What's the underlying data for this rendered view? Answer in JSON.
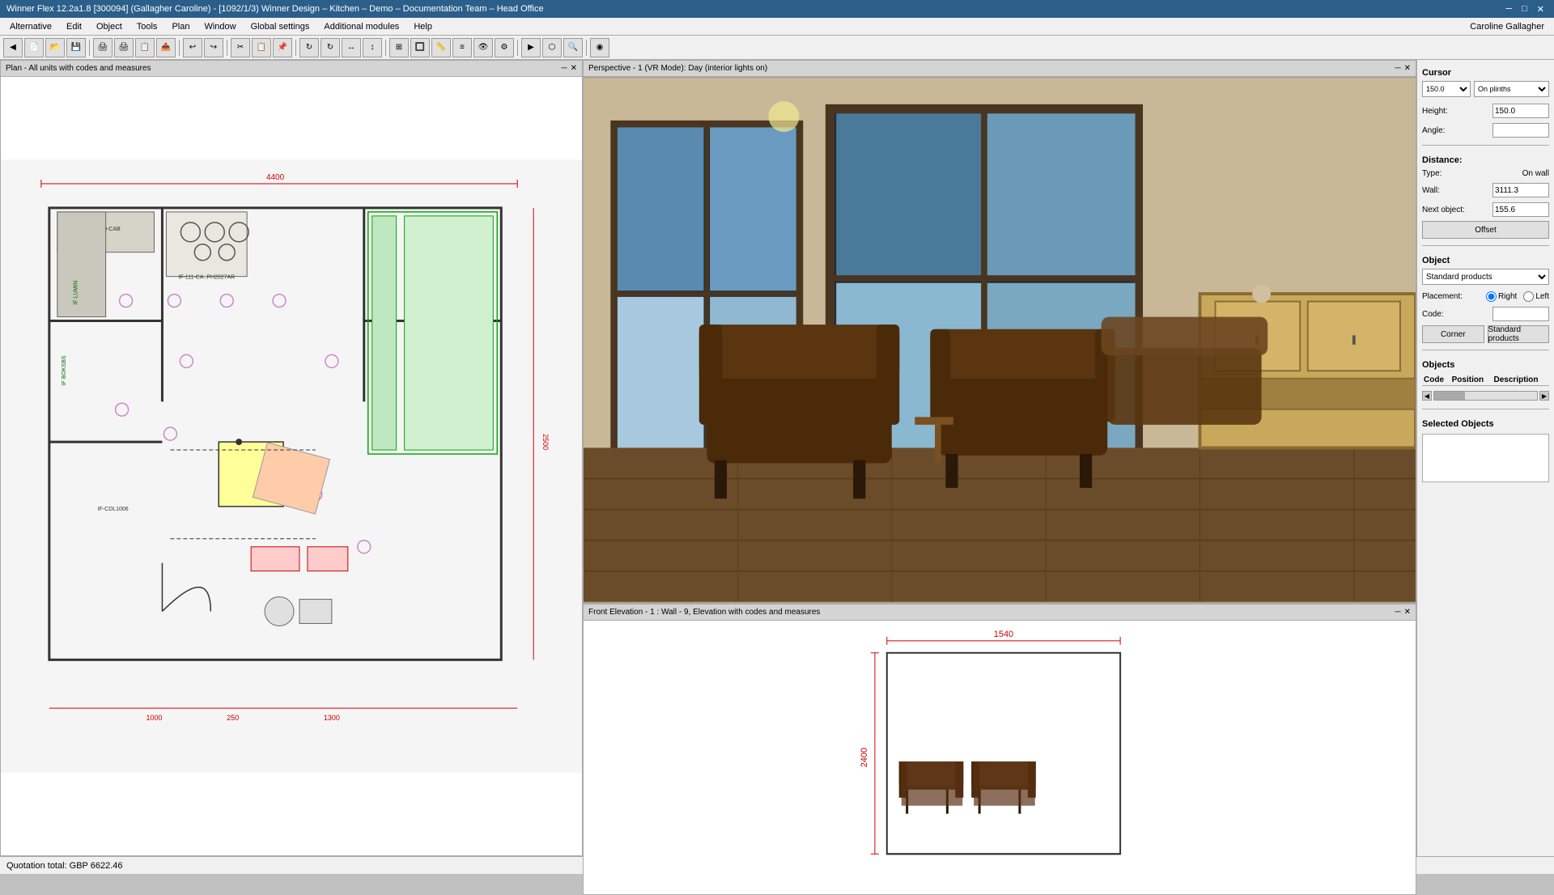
{
  "title_bar": {
    "title": "Winner Flex 12.2a1.8  [300094]  (Gallagher Caroline) - [1092/1/3) Winner Design – Kitchen – Demo – Documentation Team – Head Office",
    "minimize": "─",
    "maximize": "□",
    "close": "✕"
  },
  "menu": {
    "items": [
      "Alternative",
      "Edit",
      "Object",
      "Tools",
      "Plan",
      "Window",
      "Global settings",
      "Additional modules",
      "Help"
    ]
  },
  "toolbar": {
    "user_label": "Caroline Gallagher"
  },
  "floor_plan": {
    "title": "Plan - All units with codes and measures",
    "close": "✕"
  },
  "view_3d": {
    "title": "Perspective - 1 (VR Mode): Day (interior lights on)",
    "close": "✕"
  },
  "elevation": {
    "title": "Front Elevation - 1 : Wall - 9, Elevation with codes and measures",
    "close": "✕",
    "measurement": "1540",
    "measurement_height": "2400"
  },
  "cursor": {
    "label": "Cursor",
    "height_label": "Height:",
    "height_value": "150.0",
    "angle_label": "Angle:",
    "angle_value": "",
    "dropdown_value": "On plinths",
    "dropdown_num": "150.0"
  },
  "distance": {
    "label": "Distance:",
    "type_label": "Type:",
    "type_value": "On wall",
    "wall_label": "Wall:",
    "wall_value": "3111.3",
    "next_label": "Next object:",
    "next_value": "155.6",
    "offset_btn": "Offset"
  },
  "object": {
    "label": "Object",
    "dropdown_value": "Standard products",
    "placement_label": "Placement:",
    "placement_right": "Right",
    "placement_left": "Left",
    "code_label": "Code:",
    "code_value": "",
    "corner_btn": "Corner",
    "standard_btn": "Standard products"
  },
  "objects_table": {
    "label": "Objects",
    "columns": [
      "Code",
      "Position",
      "Description"
    ],
    "rows": []
  },
  "selected_objects": {
    "label": "Selected Objects"
  },
  "status_bar": {
    "quotation": "Quotation total: GBP 6622.46"
  }
}
